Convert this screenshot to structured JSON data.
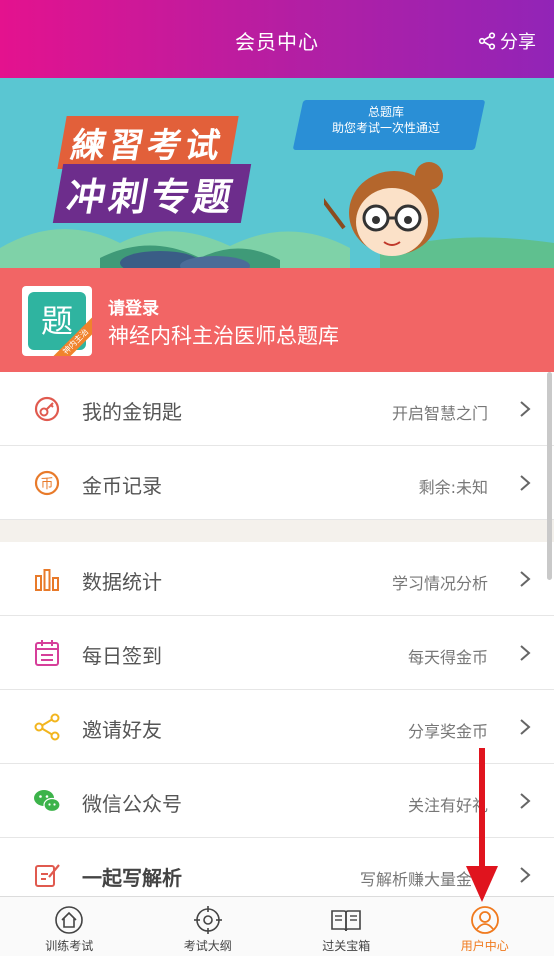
{
  "header": {
    "title": "会员中心",
    "share_label": "分享"
  },
  "banner": {
    "tag_line1": "总题库",
    "tag_line2": "助您考试一次性通过",
    "slogan_line1": "練習考试",
    "slogan_line2": "冲刺专题"
  },
  "profile": {
    "name": "请登录",
    "bank": "神经内科主治医师总题库",
    "avatar_badge": "神内主治",
    "avatar_glyph": "题"
  },
  "menu_group1": [
    {
      "label": "我的金钥匙",
      "hint": "开启智慧之门",
      "icon": "key-icon"
    },
    {
      "label": "金币记录",
      "hint": "剩余:未知",
      "icon": "coin-icon"
    }
  ],
  "menu_group2": [
    {
      "label": "数据统计",
      "hint": "学习情况分析",
      "icon": "bar-chart-icon"
    },
    {
      "label": "每日签到",
      "hint": "每天得金币",
      "icon": "calendar-icon"
    },
    {
      "label": "邀请好友",
      "hint": "分享奖金币",
      "icon": "share-icon"
    },
    {
      "label": "微信公众号",
      "hint": "关注有好礼",
      "icon": "wechat-icon"
    },
    {
      "label": "一起写解析",
      "hint": "写解析赚大量金币",
      "icon": "edit-icon"
    }
  ],
  "tabs": [
    {
      "label": "训练考试",
      "icon": "home-icon"
    },
    {
      "label": "考试大纲",
      "icon": "compass-icon"
    },
    {
      "label": "过关宝箱",
      "icon": "book-icon"
    },
    {
      "label": "用户中心",
      "icon": "user-icon",
      "active": true
    }
  ],
  "colors": {
    "header_start": "#e4128e",
    "header_end": "#9224b7",
    "login_bg": "#f26565",
    "active_tab": "#f07a1e",
    "arrow": "#e0141e"
  }
}
